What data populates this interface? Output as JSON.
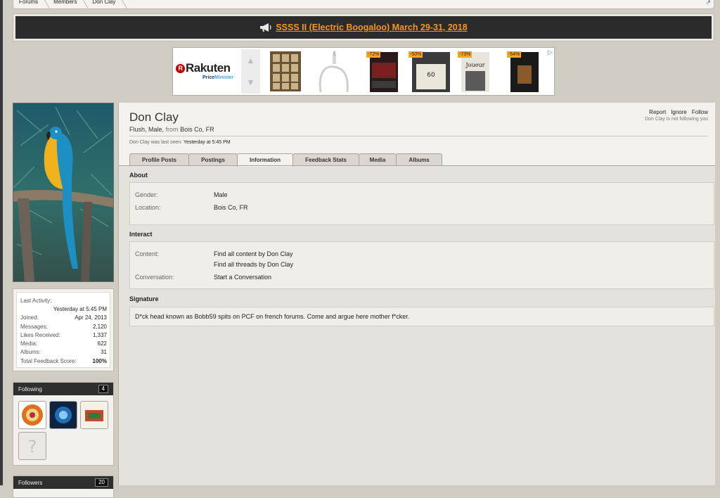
{
  "breadcrumb": {
    "items": [
      "Forums",
      "Members",
      "Don Clay"
    ]
  },
  "notice": {
    "text": "SSSS II (Electric Boogaloo) March 29-31, 2018"
  },
  "ad": {
    "brand": "Rakuten",
    "sub_a": "Price",
    "sub_b": "Minister",
    "badges": [
      "-72%",
      "-50%",
      "-73%",
      "-54%"
    ]
  },
  "profile": {
    "name": "Don Clay",
    "title": "Flush, Male,",
    "from_label": "from",
    "location": "Bois Co, FR",
    "last_seen_label": "Don Clay was last seen:",
    "last_seen_value": "Yesterday at 5:45 PM",
    "actions": [
      "Report",
      "Ignore",
      "Follow"
    ],
    "not_following": "Don Clay is not following you"
  },
  "tabs": [
    "Profile Posts",
    "Postings",
    "Information",
    "Feedback Stats",
    "Media",
    "Albums"
  ],
  "active_tab": "Information",
  "about": {
    "heading": "About",
    "rows": [
      {
        "label": "Gender:",
        "value": "Male"
      },
      {
        "label": "Location:",
        "value": "Bois Co, FR"
      }
    ]
  },
  "interact": {
    "heading": "Interact",
    "content_label": "Content:",
    "content_links": [
      "Find all content by Don Clay",
      "Find all threads by Don Clay"
    ],
    "conversation_label": "Conversation:",
    "conversation_link": "Start a Conversation"
  },
  "signature": {
    "heading": "Signature",
    "text": "D*ck head known as Bobb59 spits on PCF on french forums. Come and argue here mother f*cker."
  },
  "stats": {
    "last_activity_label": "Last Activity:",
    "last_activity_value": "Yesterday at 5:45 PM",
    "rows": [
      {
        "label": "Joined:",
        "value": "Apr 24, 2013"
      },
      {
        "label": "Messages:",
        "value": "2,120"
      },
      {
        "label": "Likes Received:",
        "value": "1,337"
      },
      {
        "label": "Media:",
        "value": "622"
      },
      {
        "label": "Albums:",
        "value": "31"
      },
      {
        "label": "Total Feedback Score:",
        "value": "100%"
      }
    ]
  },
  "following": {
    "label": "Following",
    "count": "4"
  },
  "followers": {
    "label": "Followers",
    "count": "20"
  }
}
